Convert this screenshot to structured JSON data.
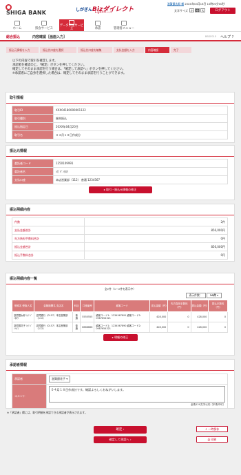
{
  "header": {
    "bank_name": "SHIGA BANK",
    "brand_prefix": "しがぎん",
    "brand_main": "Bizダイレクト",
    "brand_sub": "Lightコース",
    "company": "滋賀銀太郎 様",
    "last_login": "20XX年04月18日 10時00分00秒",
    "font_size_label": "文字サイズ",
    "font_sizes": [
      "小",
      "中",
      "大"
    ],
    "logout": "ログアウト"
  },
  "nav": {
    "items": [
      {
        "label": "ホーム"
      },
      {
        "label": "照会サービス"
      },
      {
        "label": "データ伝送サービス"
      },
      {
        "label": "承認"
      },
      {
        "label": "管理者メニュー"
      }
    ]
  },
  "subheader": {
    "left": "総合振込",
    "title": "内容確認［画面入力］",
    "screen_id": "BSGF015",
    "help": "ヘルプ"
  },
  "steps": [
    "振込元情報を入力",
    "振込先口座を選択",
    "振込先口座を編集",
    "支払金額を入力",
    "内容確認",
    "完了"
  ],
  "intro": [
    "以下の内容で取引を確定します。",
    "承認者を確認の上、「確定」ボタンを押してください。",
    "確定してそのまま承認を行う場合は、「確定して承認へ」ボタンを押してください。",
    "※承認者にご自身を選択した場合は、確定してそのまま承認を行うことができます。"
  ],
  "transaction": {
    "heading": "取引情報",
    "rows": [
      {
        "k": "取引ID",
        "v": "XXX04180000001122"
      },
      {
        "k": "取引種別",
        "v": "総合振込"
      },
      {
        "k": "振込指定日",
        "v": "20XX年04月20日"
      },
      {
        "k": "取引名",
        "v": "０４月１８日作成分"
      }
    ]
  },
  "source": {
    "heading": "振込元情報",
    "rows": [
      {
        "k": "委託者コード",
        "v": "1250109991"
      },
      {
        "k": "委託者名",
        "v": "ｼｶﾞｷﾞﾝﾀﾛｳ"
      },
      {
        "k": "支払口座",
        "v": "本店営業部（112） 普通 1234567"
      }
    ],
    "button": "取引・振込元情報の修正"
  },
  "summary": {
    "heading": "振込明細内容",
    "rows": [
      {
        "k": "件数",
        "v": "2件"
      },
      {
        "k": "支払金額合計",
        "v": "856,000円"
      },
      {
        "k": "先方負担手数料合計",
        "v": "0円"
      },
      {
        "k": "振込金額合計",
        "v": "856,000円"
      },
      {
        "k": "振込手数料合計",
        "v": "0円"
      }
    ]
  },
  "details": {
    "heading": "振込明細内容一覧",
    "count": "全2件（1〜2件を表示中）",
    "page_size_label": "表示件数：",
    "page_size": "10件",
    "headers": [
      "登録名 受取人名",
      "金融機関名 支店名",
      "科目",
      "口座番号",
      "顧客コード",
      "支払金額（円）",
      "先方負担手数料（円）",
      "振込金額（円）",
      "振込手数料（円）"
    ],
    "rows": [
      {
        "c0": "滋賀銀太郎 ｼｶﾞｷﾞﾝﾀﾛｳ",
        "c1": "滋賀銀行（0157）本店営業部（112）",
        "c2": "普通",
        "c3": "5555555",
        "c4": "顧客コード1：1234567891 顧客コード2：0987654321",
        "c5": "428,000",
        "c6": "0",
        "c7": "428,000",
        "c8": "0"
      },
      {
        "c0": "滋賀銀花子 ｼｶﾞｷﾞﾝﾊﾅｺ",
        "c1": "滋賀銀行（0157）本店営業部（112）",
        "c2": "普通",
        "c3": "6666666",
        "c4": "顧客コード1：1234567890 顧客コード2：0987654321",
        "c5": "428,000",
        "c6": "0",
        "c7": "428,000",
        "c8": "0"
      }
    ],
    "button": "明細の修正"
  },
  "approver": {
    "heading": "承認者情報",
    "approver_label": "承認者",
    "approver_value": "滋賀銀花子",
    "comment_label": "コメント",
    "comment": "０４月１８日作成分です。確認よろしくおねがいします。",
    "char_limit": "全角120文字以内［半角不可］"
  },
  "note": "※「承認者」欄には、取引明細を承認できる承認者が表示されます。",
  "buttons": {
    "confirm": "確定",
    "confirm_approve": "確定して承認へ",
    "temp_save": "一時保存",
    "print": "印刷"
  },
  "colors": {
    "accent": "#c8102e",
    "header_cell": "#d97b7b"
  }
}
